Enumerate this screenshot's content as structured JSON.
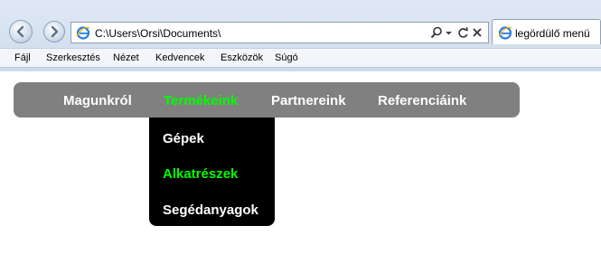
{
  "browser": {
    "address": "C:\\Users\\Orsi\\Documents\\",
    "tab_title": "legördülő menü",
    "menubar": [
      "Fájl",
      "Szerkesztés",
      "Nézet",
      "Kedvencek",
      "Eszközök",
      "Súgó"
    ]
  },
  "page": {
    "nav": [
      {
        "label": "Magunkról",
        "active": false
      },
      {
        "label": "Termékeink",
        "active": true
      },
      {
        "label": "Partnereink",
        "active": false
      },
      {
        "label": "Referenciáink",
        "active": false
      }
    ],
    "dropdown": [
      {
        "label": "Gépek",
        "active": false
      },
      {
        "label": "Alkatrészek",
        "active": true
      },
      {
        "label": "Segédanyagok",
        "active": false
      }
    ]
  },
  "colors": {
    "navbar_bg": "#808080",
    "dropdown_bg": "#000000",
    "active_text": "#00ff00",
    "text": "#ffffff"
  }
}
